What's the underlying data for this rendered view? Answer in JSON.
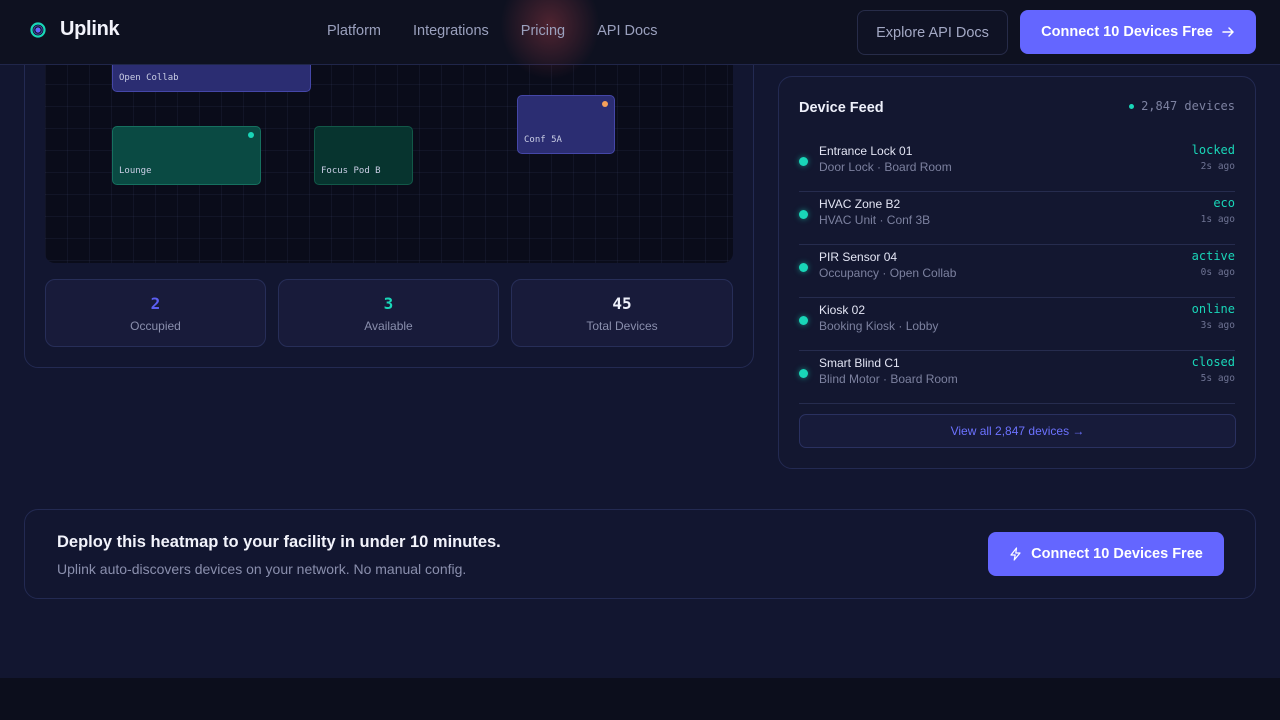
{
  "header": {
    "brand": "Uplink",
    "nav": [
      "Platform",
      "Integrations",
      "Pricing",
      "API Docs"
    ],
    "explore_label": "Explore API Docs",
    "connect_label": "Connect 10 Devices Free"
  },
  "heatmap": {
    "rooms": {
      "open_collab": "Open Collab",
      "lounge": "Lounge",
      "focus_pod_b": "Focus Pod B",
      "conf_5a": "Conf 5A"
    },
    "stats": {
      "occupied_value": "2",
      "occupied_label": "Occupied",
      "available_value": "3",
      "available_label": "Available",
      "total_value": "45",
      "total_label": "Total Devices"
    }
  },
  "feed": {
    "title": "Device Feed",
    "count": "2,847 devices",
    "items": [
      {
        "name": "Entrance Lock 01",
        "sub": "Door Lock · Board Room",
        "status": "locked",
        "time": "2s ago"
      },
      {
        "name": "HVAC Zone B2",
        "sub": "HVAC Unit · Conf 3B",
        "status": "eco",
        "time": "1s ago"
      },
      {
        "name": "PIR Sensor 04",
        "sub": "Occupancy · Open Collab",
        "status": "active",
        "time": "0s ago"
      },
      {
        "name": "Kiosk 02",
        "sub": "Booking Kiosk · Lobby",
        "status": "online",
        "time": "3s ago"
      },
      {
        "name": "Smart Blind C1",
        "sub": "Blind Motor · Board Room",
        "status": "closed",
        "time": "5s ago"
      }
    ],
    "view_all": "View all 2,847 devices →"
  },
  "cta": {
    "title": "Deploy this heatmap to your facility in under 10 minutes.",
    "subtitle": "Uplink auto-discovers devices on your network. No manual config.",
    "button": "Connect 10 Devices Free"
  },
  "colors": {
    "accent": "#6466ff",
    "available": "#19d6b8",
    "occupied": "#5c5ff2",
    "warning_dot": "#f5a05a"
  },
  "icons": [
    "uplink-logo-icon",
    "arrow-right-icon",
    "lightning-icon",
    "status-dot-icon"
  ]
}
